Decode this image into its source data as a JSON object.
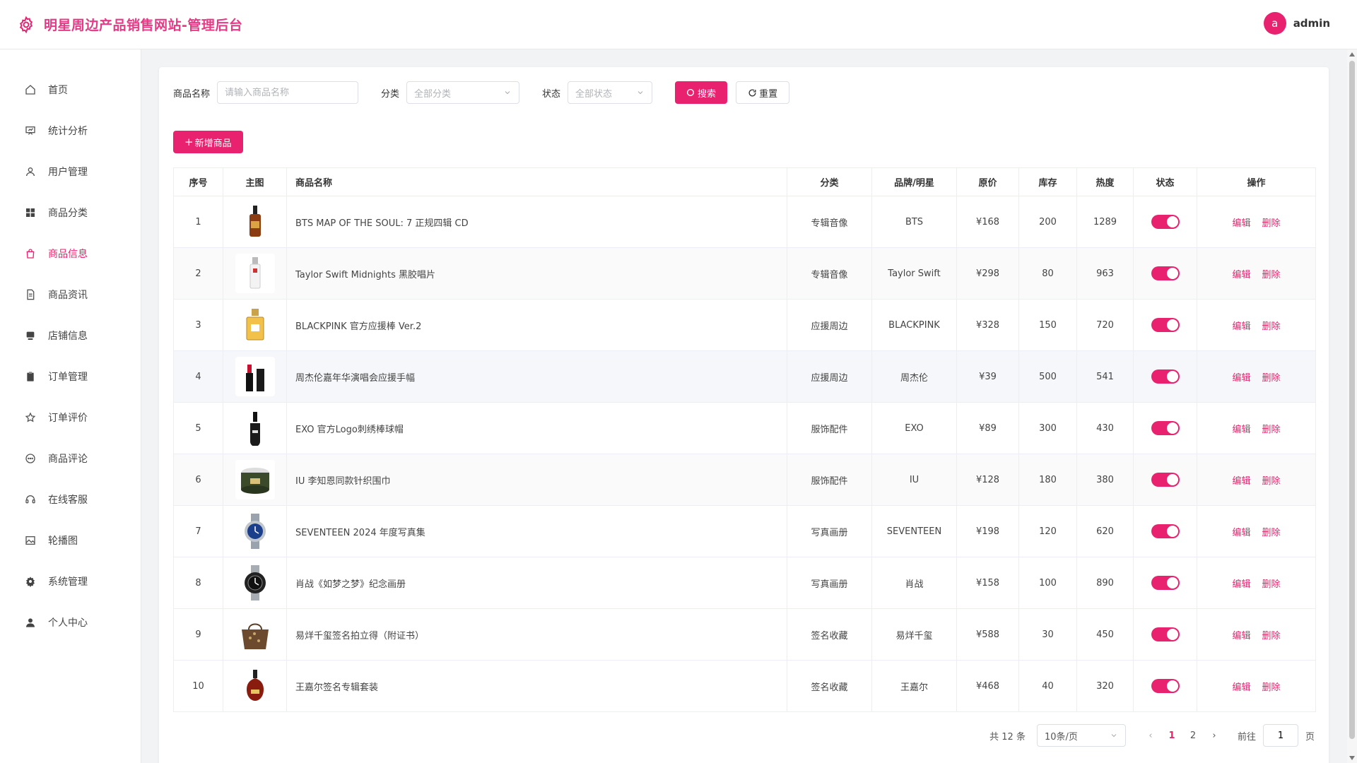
{
  "app": {
    "title": "明星周边产品销售网站-管理后台",
    "user": "admin",
    "avatar_letter": "a"
  },
  "sidebar": {
    "items": [
      {
        "label": "首页",
        "icon": "home-icon"
      },
      {
        "label": "统计分析",
        "icon": "chart-icon"
      },
      {
        "label": "用户管理",
        "icon": "user-icon"
      },
      {
        "label": "商品分类",
        "icon": "grid-icon"
      },
      {
        "label": "商品信息",
        "icon": "bag-icon",
        "active": true
      },
      {
        "label": "商品资讯",
        "icon": "document-icon"
      },
      {
        "label": "店铺信息",
        "icon": "store-icon"
      },
      {
        "label": "订单管理",
        "icon": "clipboard-icon"
      },
      {
        "label": "订单评价",
        "icon": "star-icon"
      },
      {
        "label": "商品评论",
        "icon": "comment-icon"
      },
      {
        "label": "在线客服",
        "icon": "headset-icon"
      },
      {
        "label": "轮播图",
        "icon": "image-icon"
      },
      {
        "label": "系统管理",
        "icon": "gear-icon"
      },
      {
        "label": "个人中心",
        "icon": "person-icon"
      }
    ]
  },
  "filters": {
    "name_label": "商品名称",
    "name_placeholder": "请输入商品名称",
    "category_label": "分类",
    "category_value": "全部分类",
    "status_label": "状态",
    "status_value": "全部状态",
    "search_button": "搜索",
    "reset_button": "重置"
  },
  "actions": {
    "add_button": "新增商品"
  },
  "table": {
    "headers": [
      "序号",
      "主图",
      "商品名称",
      "分类",
      "品牌/明星",
      "原价",
      "库存",
      "热度",
      "状态",
      "操作"
    ],
    "edit_label": "编辑",
    "delete_label": "删除",
    "rows": [
      {
        "no": "1",
        "name": "BTS MAP OF THE SOUL: 7 正规四辑 CD",
        "category": "专辑音像",
        "brand": "BTS",
        "price": "¥168",
        "stock": "200",
        "heat": "1289",
        "status_on": true,
        "thumb": "serum-bottle"
      },
      {
        "no": "2",
        "name": "Taylor Swift Midnights 黑胶唱片",
        "category": "专辑音像",
        "brand": "Taylor Swift",
        "price": "¥298",
        "stock": "80",
        "heat": "963",
        "status_on": true,
        "thumb": "essence-bottle"
      },
      {
        "no": "3",
        "name": "BLACKPINK 官方应援棒 Ver.2",
        "category": "应援周边",
        "brand": "BLACKPINK",
        "price": "¥328",
        "stock": "150",
        "heat": "720",
        "status_on": true,
        "thumb": "perfume-bottle"
      },
      {
        "no": "4",
        "name": "周杰伦嘉年华演唱会应援手幅",
        "category": "应援周边",
        "brand": "周杰伦",
        "price": "¥39",
        "stock": "500",
        "heat": "541",
        "status_on": true,
        "thumb": "lipstick"
      },
      {
        "no": "5",
        "name": "EXO 官方Logo刺绣棒球帽",
        "category": "服饰配件",
        "brand": "EXO",
        "price": "¥89",
        "stock": "300",
        "heat": "430",
        "status_on": true,
        "thumb": "dropper-bottle"
      },
      {
        "no": "6",
        "name": "IU 李知恩同款针织围巾",
        "category": "服饰配件",
        "brand": "IU",
        "price": "¥128",
        "stock": "180",
        "heat": "380",
        "status_on": true,
        "thumb": "cream-jar"
      },
      {
        "no": "7",
        "name": "SEVENTEEN 2024 年度写真集",
        "category": "写真画册",
        "brand": "SEVENTEEN",
        "price": "¥198",
        "stock": "120",
        "heat": "620",
        "status_on": true,
        "thumb": "blue-watch"
      },
      {
        "no": "8",
        "name": "肖战《如梦之梦》纪念画册",
        "category": "写真画册",
        "brand": "肖战",
        "price": "¥158",
        "stock": "100",
        "heat": "890",
        "status_on": true,
        "thumb": "black-watch"
      },
      {
        "no": "9",
        "name": "易烊千玺签名拍立得（附证书）",
        "category": "签名收藏",
        "brand": "易烊千玺",
        "price": "¥588",
        "stock": "30",
        "heat": "450",
        "status_on": true,
        "thumb": "handbag"
      },
      {
        "no": "10",
        "name": "王嘉尔签名专辑套装",
        "category": "签名收藏",
        "brand": "王嘉尔",
        "price": "¥468",
        "stock": "40",
        "heat": "320",
        "status_on": true,
        "thumb": "cognac-bottle"
      }
    ]
  },
  "pagination": {
    "total": "共 12 条",
    "page_size": "10条/页",
    "pages": [
      "1",
      "2"
    ],
    "current": "1",
    "goto_label": "前往",
    "goto_value": "1",
    "page_suffix": "页"
  },
  "colors": {
    "accent": "#e8226f",
    "title": "#e53a86"
  }
}
